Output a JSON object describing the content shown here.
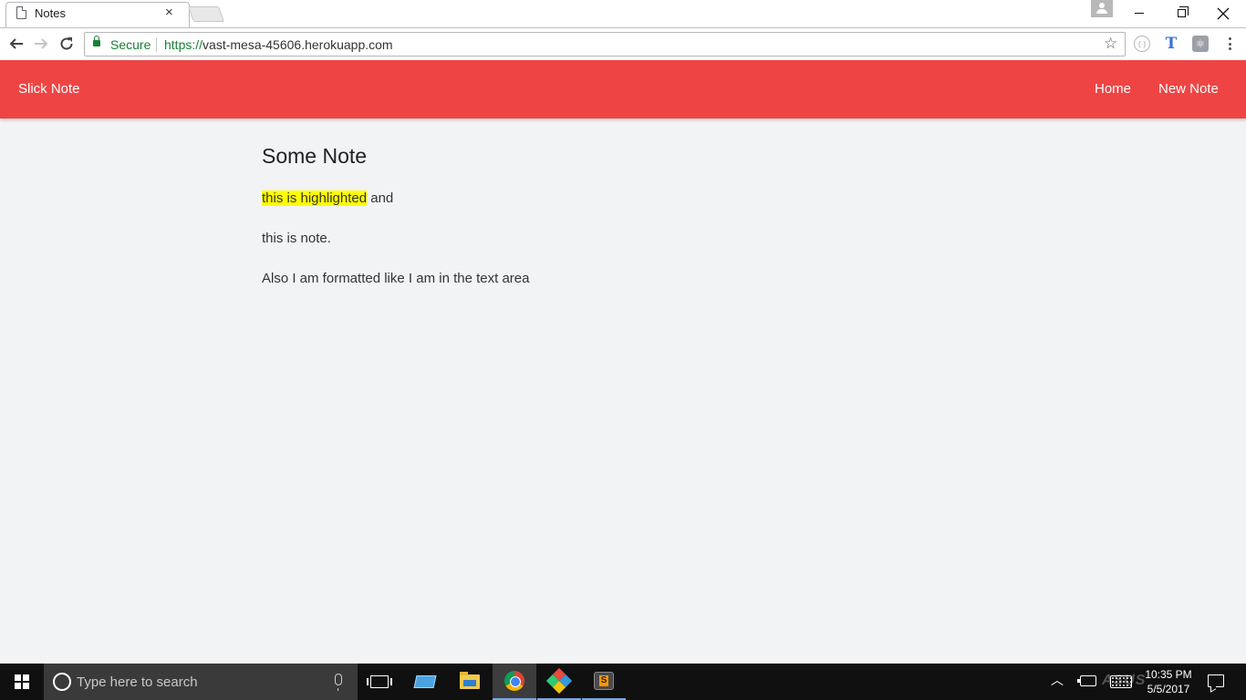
{
  "browser": {
    "tab": {
      "title": "Notes",
      "close_glyph": "×"
    },
    "omnibox": {
      "secure_label": "Secure",
      "url_scheme": "https://",
      "url_host": "vast-mesa-45606.herokuapp.com"
    }
  },
  "app": {
    "brand": "Slick Note",
    "nav": {
      "home": "Home",
      "new_note": "New Note"
    },
    "accent_color": "#ef4444"
  },
  "note": {
    "title": "Some Note",
    "highlighted_text": "this is highlighted",
    "after_highlight": " and",
    "line2": "this is note.",
    "line3": "Also I am formatted like I am in the text area",
    "highlight_color": "#ffff00"
  },
  "taskbar": {
    "search_placeholder": "Type here to search",
    "time": "10:35 PM",
    "date": "5/5/2017",
    "watermark": "ASUS"
  }
}
